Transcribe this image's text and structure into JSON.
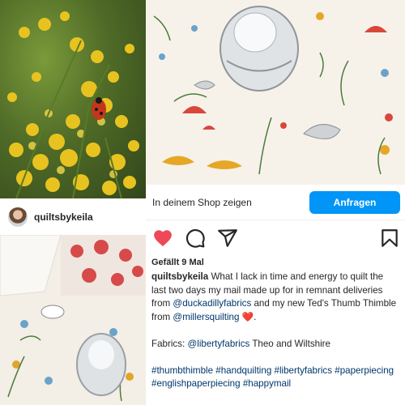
{
  "feed": {
    "left_profile": {
      "username": "quiltsbykeila"
    },
    "shop_bar": {
      "label": "In deinem Shop zeigen",
      "button_label": "Anfragen"
    },
    "post": {
      "likes_text": "Gefällt 9 Mal",
      "username": "quiltsbykeila",
      "caption_text_1": "What I lack in time and energy to quilt the last two days my mail made up for in remnant deliveries from",
      "mention_1": "@duckadillyfabrics",
      "caption_text_2": "and my new Ted's Thumb Thimble from",
      "mention_2": "@millersquilting",
      "heart_emoji": "❤️",
      "caption_text_3": ".",
      "fabrics_prefix": "Fabrics:",
      "mention_3": "@libertyfabrics",
      "fabrics_suffix": "Theo and Wiltshire",
      "hashtags": [
        "#thumbthimble",
        "#handquilting",
        "#libertyfabrics",
        "#paperpiecing",
        "#englishpaperpiecing",
        "#happymail"
      ]
    },
    "icons": {
      "like": "heart-filled-icon",
      "comment": "comment-bubble-icon",
      "share": "send-paper-plane-icon",
      "save": "bookmark-icon"
    },
    "colors": {
      "accent": "#0095f6",
      "like": "#ed4956",
      "link": "#00376b",
      "text": "#262626"
    }
  }
}
